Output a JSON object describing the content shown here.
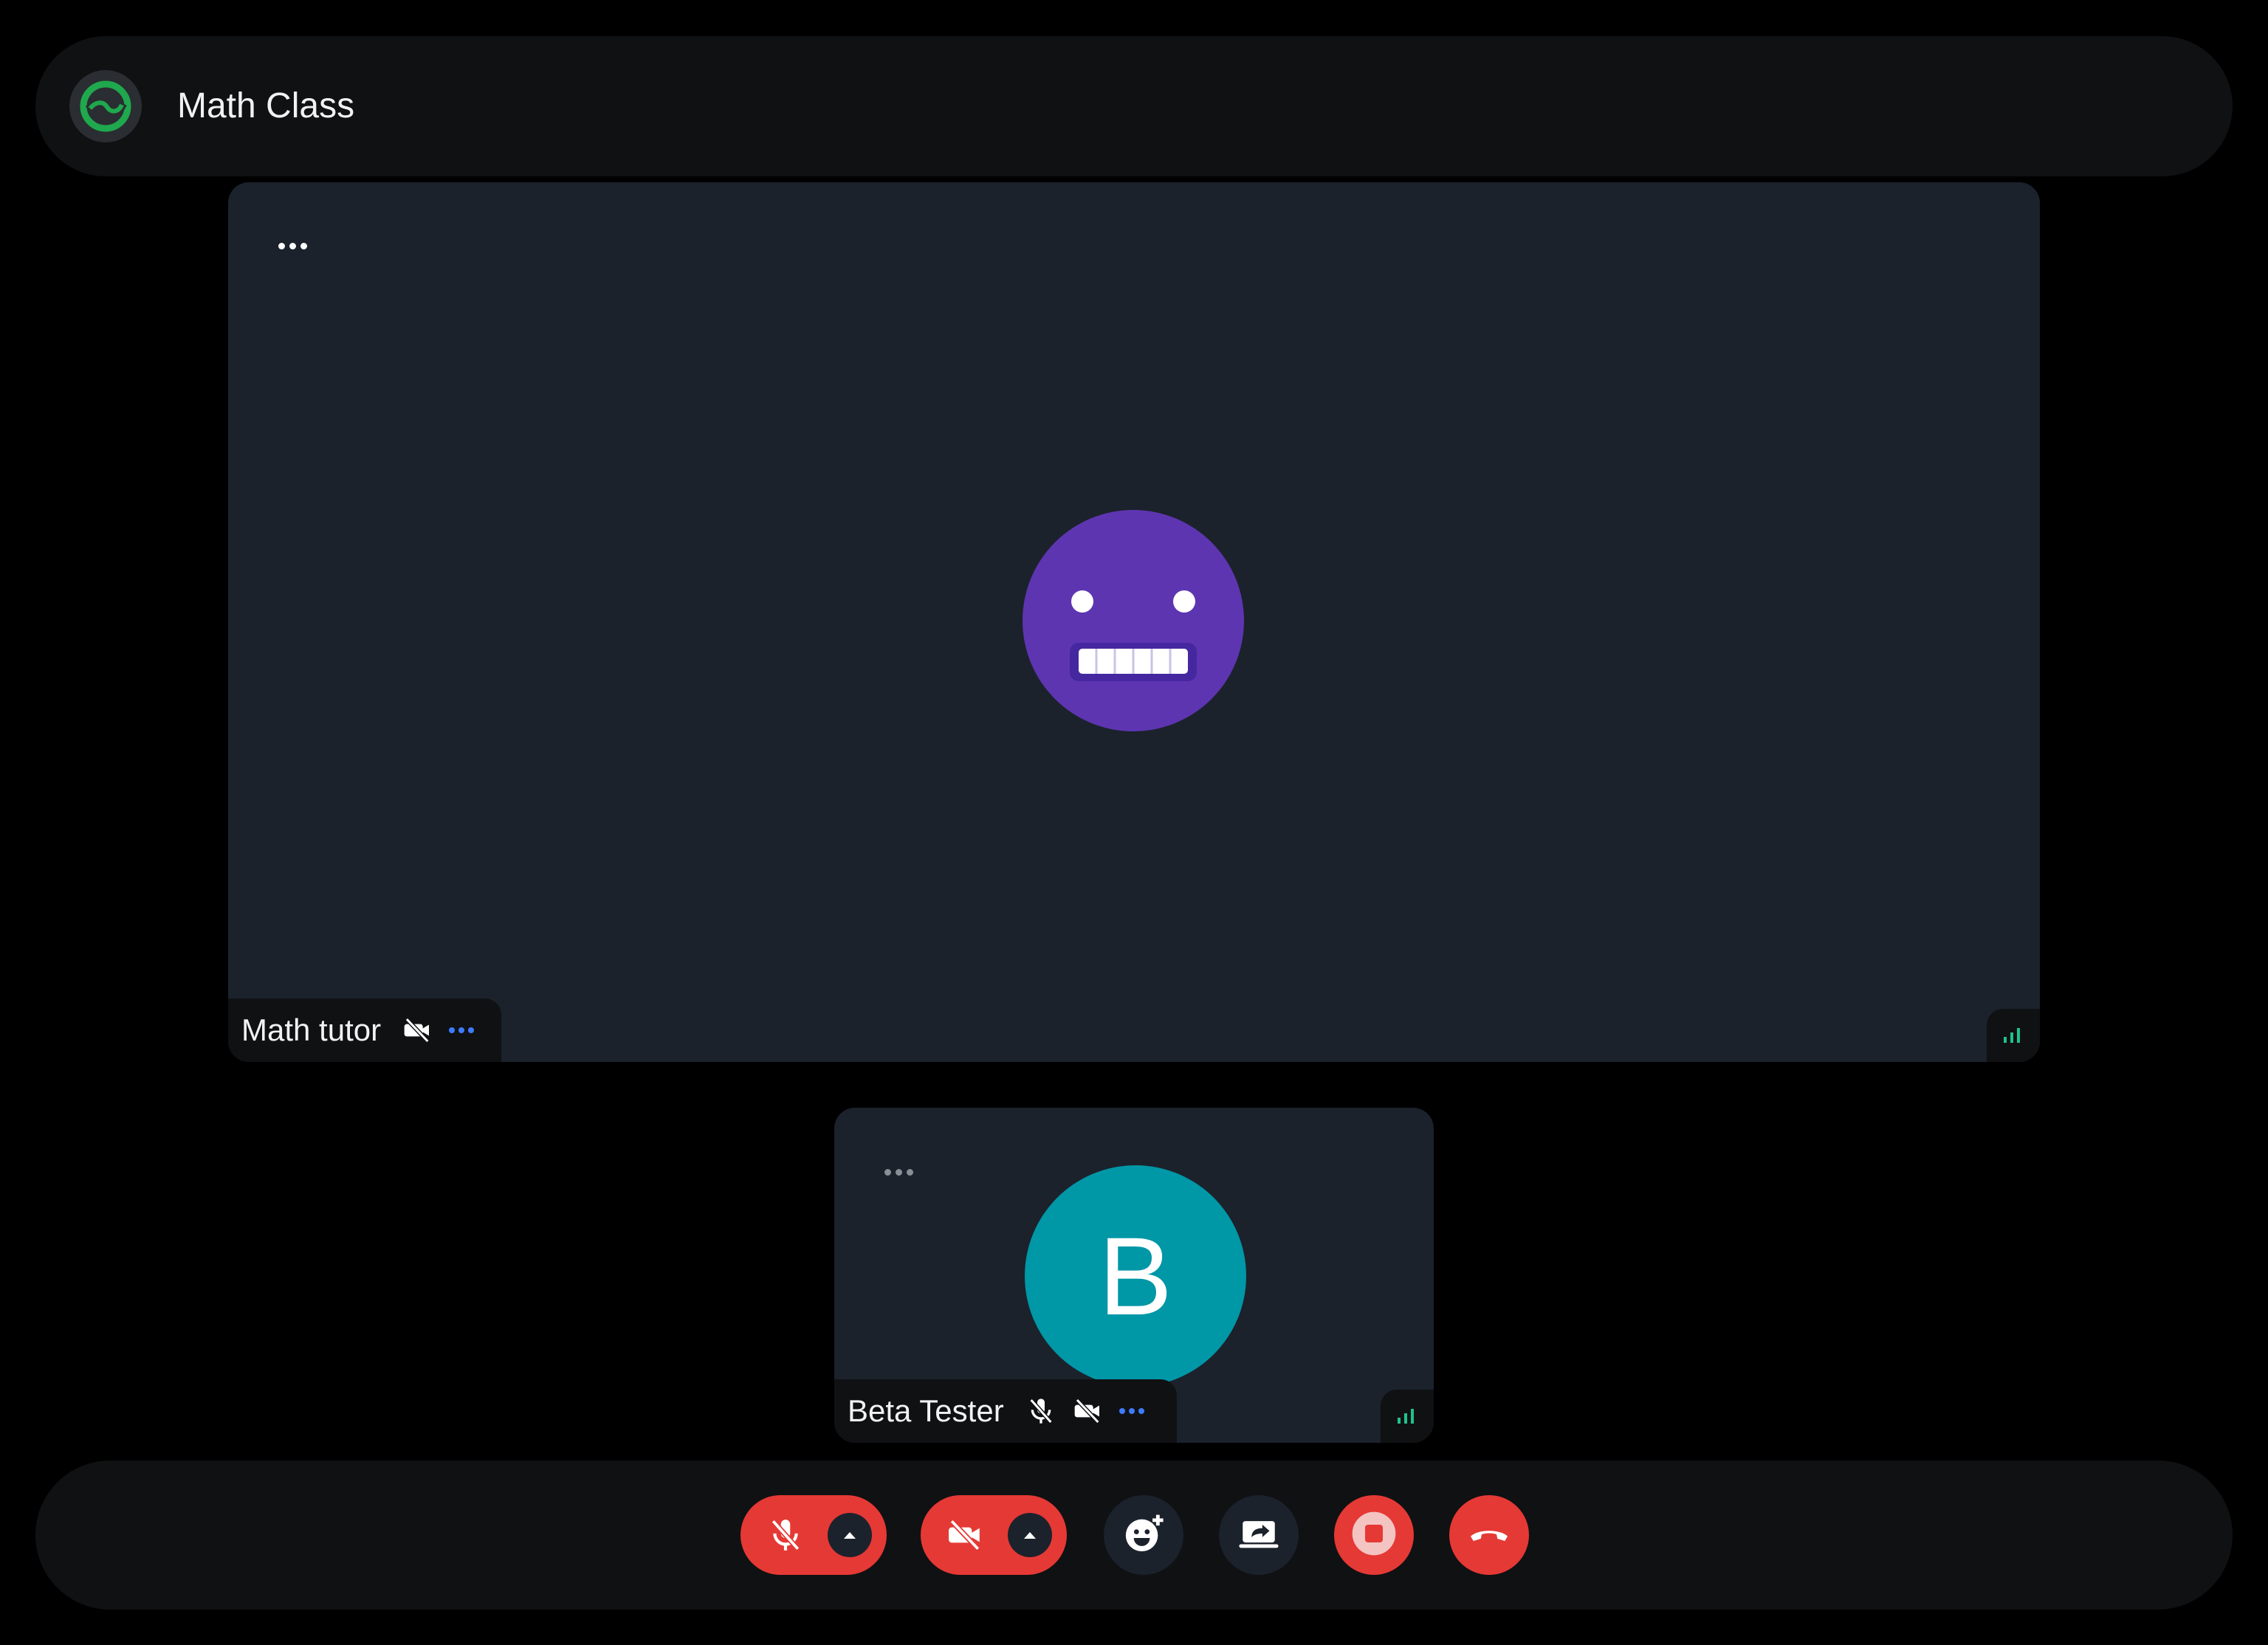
{
  "header": {
    "room_title": "Math Class",
    "logo_icon": "refresh-logo-icon"
  },
  "main_participant": {
    "name": "Math tutor",
    "avatar": "grimace-emoji-avatar",
    "camera": "off",
    "menu_icon": "more-icon"
  },
  "secondary_participant": {
    "name": "Beta Tester",
    "avatar_letter": "B",
    "microphone": "off",
    "camera": "off"
  },
  "controls": {
    "microphone": "mic-off-icon",
    "camera": "camera-off-icon",
    "reactions": "emoji-add-icon",
    "screen_share": "screen-share-icon",
    "record": "stop-record-icon",
    "leave": "hang-up-icon"
  },
  "colors": {
    "background": "#000000",
    "bar": "#101113",
    "tile": "#1b222c",
    "danger": "#e53935",
    "emoji_avatar": "#5e35b1",
    "letter_avatar": "#0097a7",
    "signal": "#1ec28b",
    "menu_accent": "#3d7bff"
  }
}
